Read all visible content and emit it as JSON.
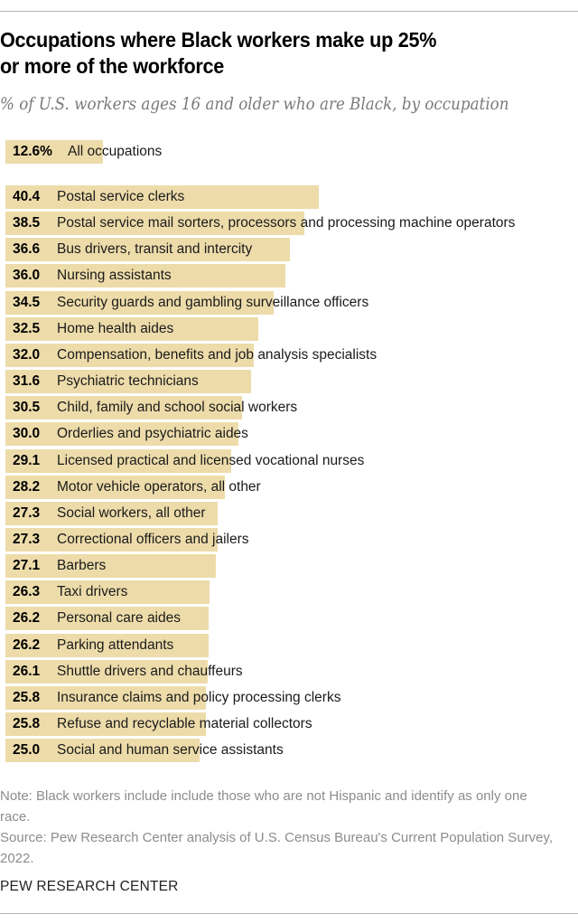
{
  "header": {
    "title_line1": "Occupations where Black workers make up 25%",
    "title_line2": "or more of the workforce",
    "subtitle": "% of U.S. workers ages 16 and older who are Black, by occupation"
  },
  "colors": {
    "bar": "#eddcaa",
    "subtitle": "#7a7a7a",
    "note": "#8c8c8c"
  },
  "chart_data": {
    "type": "bar",
    "orientation": "horizontal",
    "title": "Occupations where Black workers make up 25% or more of the workforce",
    "subtitle": "% of U.S. workers ages 16 and older who are Black, by occupation",
    "xlabel": "",
    "ylabel": "",
    "xlim": [
      0,
      74
    ],
    "grid": false,
    "summary": {
      "category": "All occupations",
      "value": 12.6,
      "label": "12.6%"
    },
    "categories": [
      "Postal service clerks",
      "Postal service mail sorters, processors and processing machine operators",
      "Bus drivers, transit and intercity",
      "Nursing assistants",
      "Security guards and gambling surveillance officers",
      "Home health aides",
      "Compensation, benefits and job analysis specialists",
      "Psychiatric technicians",
      "Child, family and school social workers",
      "Orderlies and psychiatric aides",
      "Licensed practical and licensed vocational nurses",
      "Motor vehicle operators, all other",
      "Social workers, all other",
      "Correctional officers and jailers",
      "Barbers",
      "Taxi drivers",
      "Personal care aides",
      "Parking attendants",
      "Shuttle drivers and chauffeurs",
      "Insurance claims and policy processing clerks",
      "Refuse and recyclable material collectors",
      "Social and human service assistants"
    ],
    "values": [
      40.4,
      38.5,
      36.6,
      36.0,
      34.5,
      32.5,
      32.0,
      31.6,
      30.5,
      30.0,
      29.1,
      28.2,
      27.3,
      27.3,
      27.1,
      26.3,
      26.2,
      26.2,
      26.1,
      25.8,
      25.8,
      25.0
    ],
    "value_labels": [
      "40.4",
      "38.5",
      "36.6",
      "36.0",
      "34.5",
      "32.5",
      "32.0",
      "31.6",
      "30.5",
      "30.0",
      "29.1",
      "28.2",
      "27.3",
      "27.3",
      "27.1",
      "26.3",
      "26.2",
      "26.2",
      "26.1",
      "25.8",
      "25.8",
      "25.0"
    ]
  },
  "footer": {
    "note": "Note: Black workers include include those who are not Hispanic and identify as only one race.",
    "source": "Source: Pew Research Center analysis of U.S. Census Bureau's Current Population Survey, 2022.",
    "brand": "PEW RESEARCH CENTER"
  }
}
